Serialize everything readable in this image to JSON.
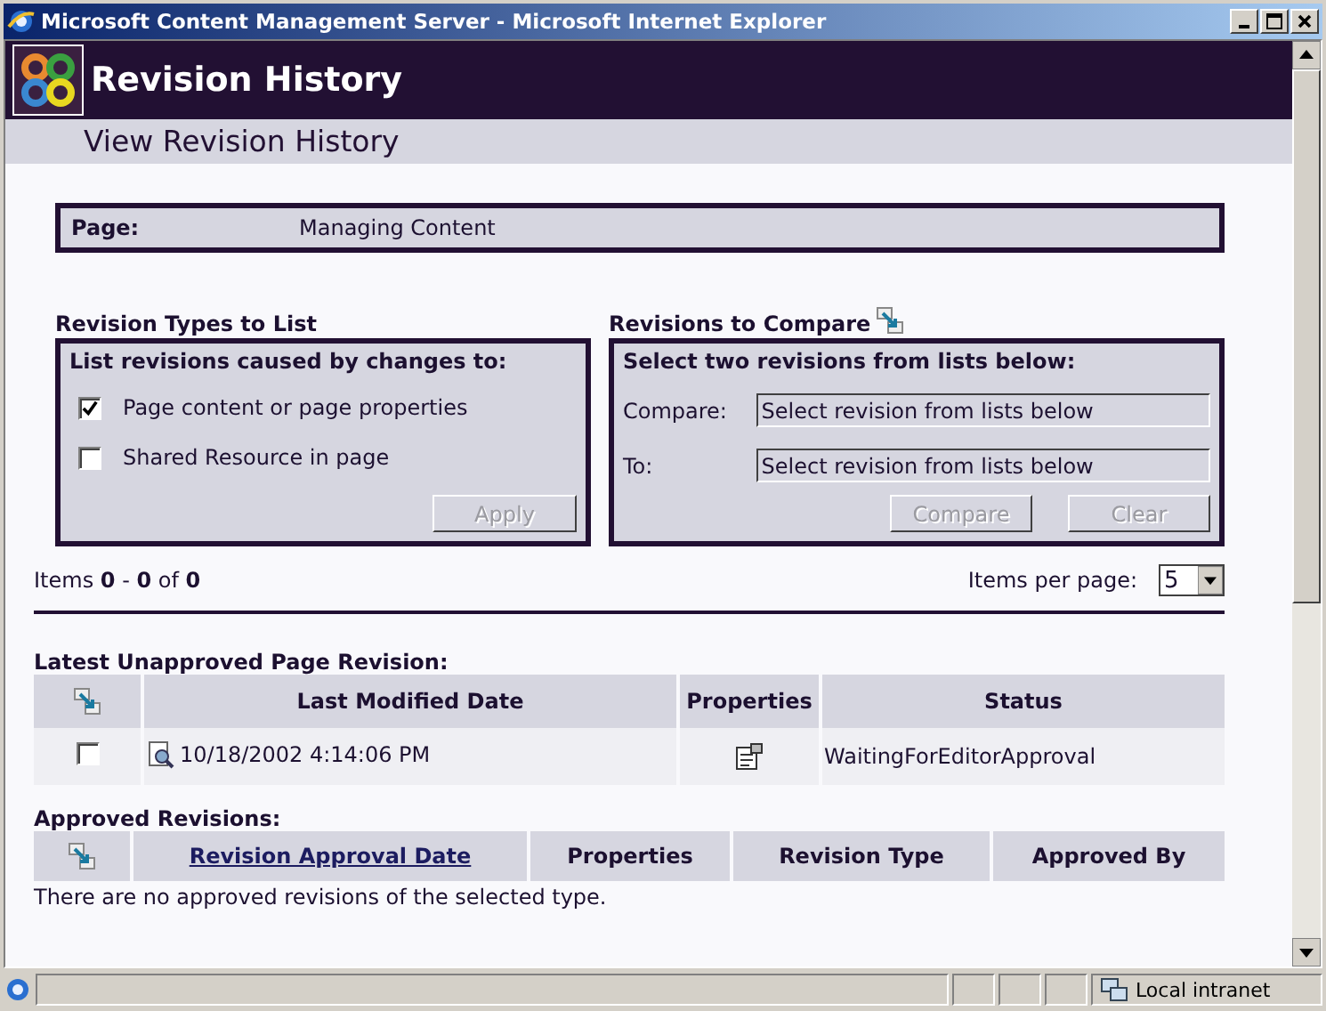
{
  "window": {
    "title": "Microsoft Content Management Server - Microsoft Internet Explorer"
  },
  "banner": {
    "title": "Revision History",
    "subtitle": "View Revision History"
  },
  "page_info": {
    "label": "Page:",
    "value": "Managing Content"
  },
  "revision_types": {
    "heading": "Revision Types to List",
    "prompt": "List revisions caused by changes to:",
    "options": [
      {
        "label": "Page content or page properties",
        "checked": true
      },
      {
        "label": "Shared Resource in page",
        "checked": false
      }
    ],
    "apply_button": {
      "label": "Apply",
      "disabled": true
    }
  },
  "compare": {
    "heading": "Revisions to Compare",
    "prompt": "Select two revisions from lists below:",
    "fields": [
      {
        "label": "Compare:",
        "value": "Select revision from lists below"
      },
      {
        "label": "To:",
        "value": "Select revision from lists below"
      }
    ],
    "buttons": [
      {
        "label": "Compare",
        "disabled": true
      },
      {
        "label": "Clear",
        "disabled": true
      }
    ]
  },
  "paging": {
    "summary": "Items **0** - **0** of **0**",
    "per_page_label": "Items per page:",
    "per_page_value": "5"
  },
  "unapproved": {
    "heading": "Latest Unapproved Page Revision:",
    "columns": [
      {
        "kind": "icon"
      },
      {
        "kind": "text",
        "label": "Last Modified Date"
      },
      {
        "kind": "text",
        "label": "Properties"
      },
      {
        "kind": "text",
        "label": "Status"
      }
    ],
    "rows": [
      {
        "checked": false,
        "date": "10/18/2002 4:14:06 PM",
        "status": "WaitingForEditorApproval"
      }
    ]
  },
  "approved": {
    "heading": "Approved Revisions:",
    "columns": [
      {
        "kind": "icon"
      },
      {
        "kind": "link",
        "label": "Revision Approval Date"
      },
      {
        "kind": "text",
        "label": "Properties"
      },
      {
        "kind": "text",
        "label": "Revision Type"
      },
      {
        "kind": "text",
        "label": "Approved By"
      }
    ],
    "empty_message": "There are no approved revisions of the selected type."
  },
  "status_bar": {
    "zone": "Local intranet"
  }
}
